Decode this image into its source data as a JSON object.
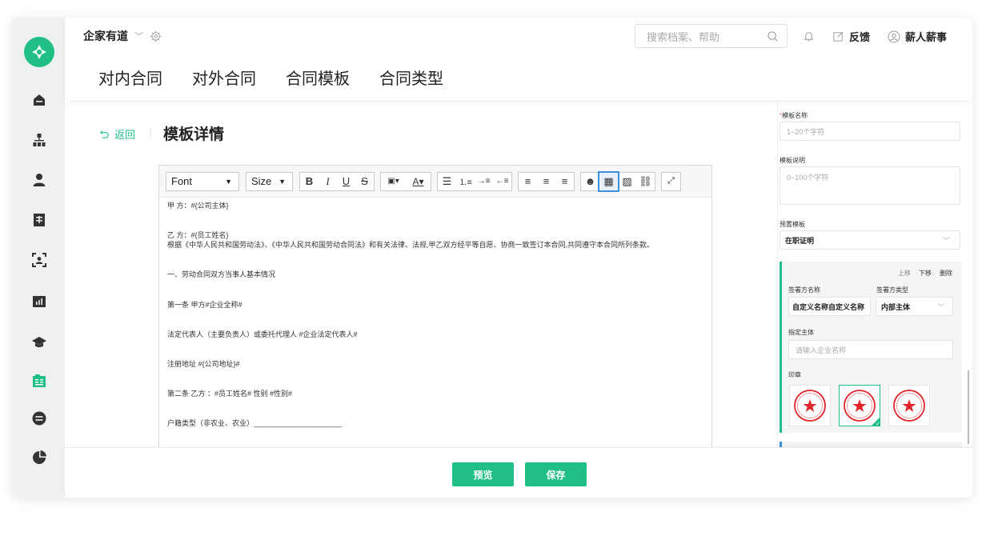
{
  "header": {
    "company": "企家有道",
    "search_placeholder": "搜索档案、帮助",
    "feedback": "反馈",
    "user": "薪人薪事"
  },
  "tabs": [
    {
      "label": "对内合同"
    },
    {
      "label": "对外合同"
    },
    {
      "label": "合同模板"
    },
    {
      "label": "合同类型"
    }
  ],
  "page": {
    "back": "返回",
    "title": "模板详情"
  },
  "toolbar": {
    "font": "Font",
    "size": "Size"
  },
  "editor_lines": [
    "甲 方：#{公司主体}",
    "",
    "乙 方：#{员工姓名}",
    "根据《中华人民共和国劳动法》、《中华人民共和国劳动合同法》和有关法律、法规,甲乙双方经平等自愿、协商一致签订本合同,共同遵守本合同所列条款。",
    "",
    "一、劳动合同双方当事人基本情况",
    "",
    "第一条 甲方#企业全称#",
    "",
    "法定代表人（主要负责人）或委托代理人 #企业法定代表人#",
    "",
    "注册地址 #{公司地址}#",
    "",
    "第二条 乙方 ：#员工姓名#        性别 #性别#",
    "",
    "户籍类型（非农业、农业）______________________"
  ],
  "form": {
    "name_label": "模板名称",
    "name_placeholder": "1~20个字符",
    "desc_label": "模板说明",
    "desc_placeholder": "0~100个字符",
    "preset_label": "预置模板",
    "preset_value": "在职证明"
  },
  "signer": {
    "up": "上移",
    "down": "下移",
    "delete": "删除",
    "name_label": "签署方名称",
    "type_label": "签署方类型",
    "name_value": "自定义名称自定义名称",
    "type_value": "内部主体",
    "entity_label": "指定主体",
    "entity_placeholder": "请输入企业名称",
    "seal_label": "印章"
  },
  "footer": {
    "preview": "预览",
    "save": "保存"
  },
  "colors": {
    "accent": "#1fbf85",
    "secondary": "#3d8fe0",
    "sidebar_bg": "#eef0f2",
    "seal_red": "#e0262c"
  }
}
